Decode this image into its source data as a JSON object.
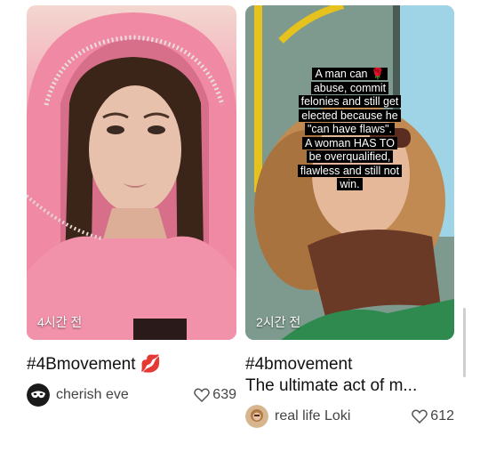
{
  "cards": [
    {
      "time_ago": "4시간 전",
      "title": "#4Bmovement",
      "title_emoji": "💋",
      "author": "cherish eve",
      "likes": "639",
      "avatar_icon": "mask-icon"
    },
    {
      "time_ago": "2시간 전",
      "overlay_lines": [
        "A man can 🌹",
        "abuse, commit",
        "felonies and still get",
        "elected because he",
        "\"can have flaws\".",
        "A woman HAS TO",
        "be overqualified,",
        "flawless and still not",
        "win."
      ],
      "title_line1": "#4bmovement",
      "title_line2": "The ultimate act of m...",
      "author": "real life Loki",
      "likes": "612",
      "avatar_icon": "portrait-avatar"
    }
  ]
}
